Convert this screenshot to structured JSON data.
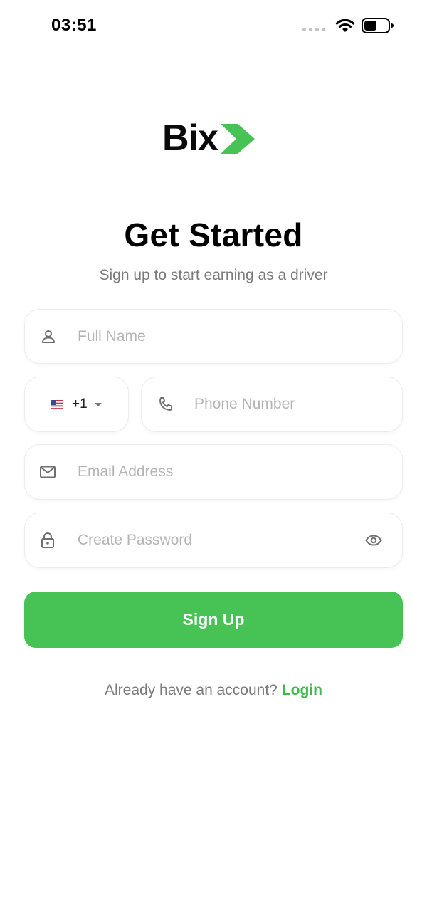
{
  "status_bar": {
    "time": "03:51"
  },
  "brand": {
    "name": "Bix",
    "accent": "#47c255"
  },
  "header": {
    "title": "Get Started",
    "subtitle": "Sign up to start earning as a driver"
  },
  "form": {
    "full_name": {
      "placeholder": "Full Name",
      "icon": "person-icon"
    },
    "country": {
      "flag": "us-flag-icon",
      "code": "+1"
    },
    "phone": {
      "placeholder": "Phone Number",
      "icon": "phone-icon"
    },
    "email": {
      "placeholder": "Email Address",
      "icon": "mail-icon"
    },
    "password": {
      "placeholder": "Create Password",
      "icon": "lock-icon",
      "toggle_icon": "eye-icon"
    }
  },
  "actions": {
    "signup_label": "Sign Up"
  },
  "footer": {
    "prompt": "Already have an account?",
    "login_label": "Login"
  }
}
